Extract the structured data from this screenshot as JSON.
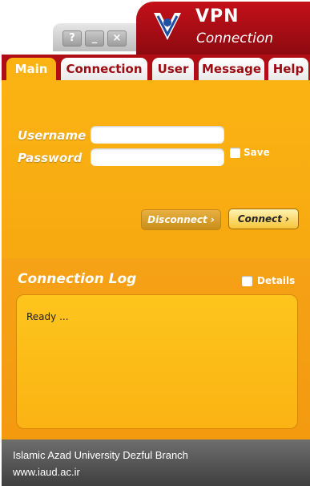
{
  "window": {
    "help_label": "?",
    "minimize_label": "_",
    "close_label": "×"
  },
  "header": {
    "title": "VPN",
    "subtitle": "Connection"
  },
  "tabs": [
    {
      "label": "Main"
    },
    {
      "label": "Connection"
    },
    {
      "label": "User"
    },
    {
      "label": "Message"
    },
    {
      "label": "Help"
    }
  ],
  "main": {
    "username_label": "Username",
    "password_label": "Password",
    "username_value": "",
    "password_value": "",
    "save_label": "Save",
    "disconnect_label": "Disconnect ›",
    "connect_label": "Connect ›"
  },
  "log": {
    "title": "Connection Log",
    "details_label": "Details",
    "text": "Ready ..."
  },
  "footer": {
    "line1": "Islamic Azad University Dezful Branch",
    "line2": "www.iaud.ac.ir"
  },
  "colors": {
    "brand_red": "#b00d15",
    "panel_orange": "#fbb313",
    "log_orange": "#f39a0f"
  }
}
